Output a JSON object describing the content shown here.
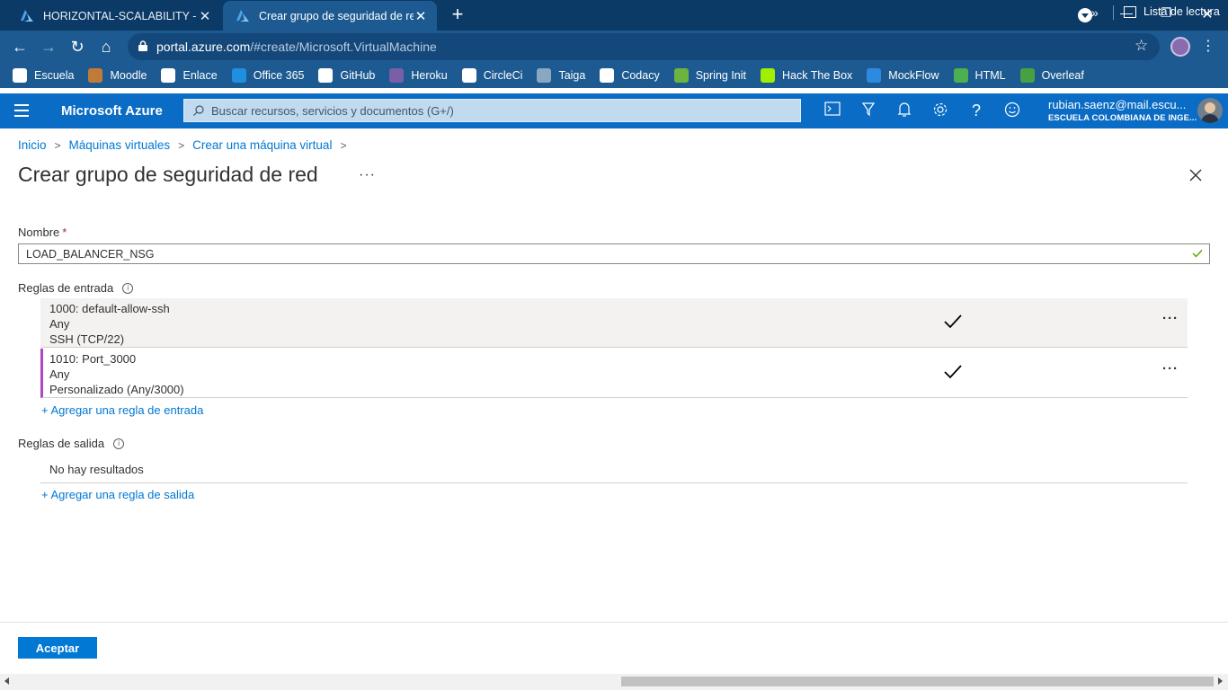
{
  "browser": {
    "tabs": [
      {
        "title": "HORIZONTAL-SCALABILITY - Microsoft Azure",
        "active": false
      },
      {
        "title": "Crear grupo de seguridad de red - Microsoft Azure",
        "active": true
      }
    ],
    "url_host": "portal.azure.com",
    "url_path": "/#create/Microsoft.VirtualMachine",
    "bookmarks": [
      "Escuela",
      "Moodle",
      "Enlace",
      "Office 365",
      "GitHub",
      "Heroku",
      "CircleCi",
      "Taiga",
      "Codacy",
      "Spring Init",
      "Hack The Box",
      "MockFlow",
      "HTML",
      "Overleaf"
    ],
    "bookmark_colors": [
      "#ffffff",
      "#c07b39",
      "#ffffff",
      "#1f8fe0",
      "#ffffff",
      "#7b5ea8",
      "#ffffff",
      "#8aa7c0",
      "#ffffff",
      "#6db33f",
      "#9fef00",
      "#2e8ae0",
      "#4caf50",
      "#47a141"
    ],
    "reading_list": "Lista de lectura"
  },
  "azure": {
    "brand": "Microsoft Azure",
    "search_placeholder": "Buscar recursos, servicios y documentos (G+/)",
    "user_email": "rubian.saenz@mail.escu...",
    "user_org": "ESCUELA COLOMBIANA DE INGE..."
  },
  "breadcrumb": [
    "Inicio",
    "Máquinas virtuales",
    "Crear una máquina virtual"
  ],
  "page": {
    "title": "Crear grupo de seguridad de red",
    "more": "···"
  },
  "form": {
    "name_label": "Nombre",
    "required_mark": "*",
    "name_value": "LOAD_BALANCER_NSG",
    "inbound_label": "Reglas de entrada",
    "inbound_rules": [
      {
        "name": "1000: default-allow-ssh",
        "source": "Any",
        "service": "SSH (TCP/22)"
      },
      {
        "name": "1010: Port_3000",
        "source": "Any",
        "service": "Personalizado (Any/3000)"
      }
    ],
    "add_inbound": "+ Agregar una regla de entrada",
    "outbound_label": "Reglas de salida",
    "no_results": "No hay resultados",
    "add_outbound": "+ Agregar una regla de salida",
    "row_more": "···"
  },
  "footer": {
    "accept_label": "Aceptar"
  },
  "colors": {
    "azure_blue": "#0078d4",
    "header_blue": "#0a6cc4",
    "accent_purple": "#b146c2"
  }
}
